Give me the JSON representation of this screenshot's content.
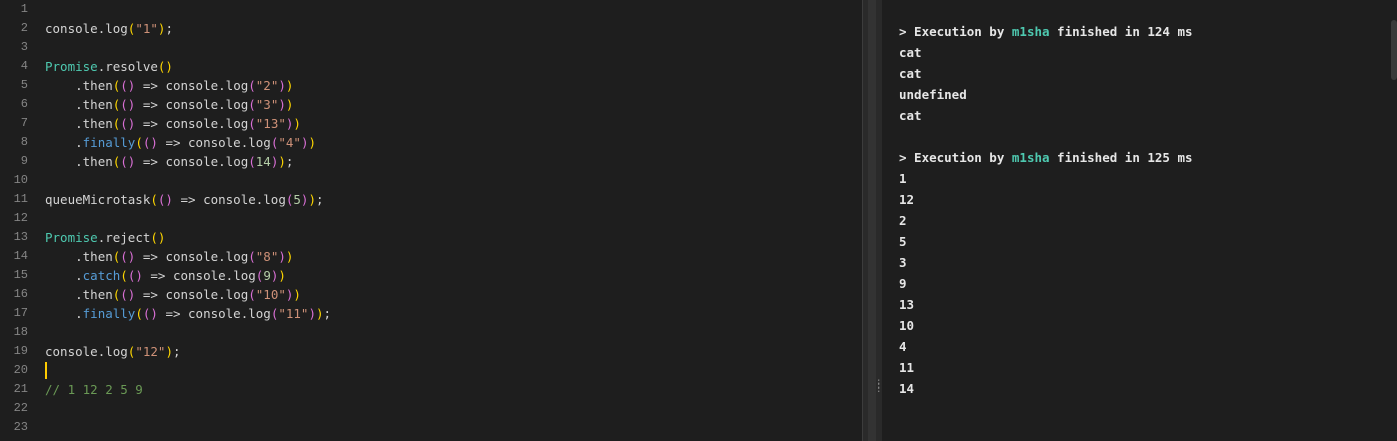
{
  "editor": {
    "line_numbers": [
      "1",
      "2",
      "3",
      "4",
      "5",
      "6",
      "7",
      "8",
      "9",
      "10",
      "11",
      "12",
      "13",
      "14",
      "15",
      "16",
      "17",
      "18",
      "19",
      "20",
      "21",
      "22",
      "23"
    ],
    "lines": [
      [],
      [
        {
          "t": "console",
          "c": "plain"
        },
        {
          "t": ".",
          "c": "pun"
        },
        {
          "t": "log",
          "c": "plain"
        },
        {
          "t": "(",
          "c": "b1"
        },
        {
          "t": "\"1\"",
          "c": "str"
        },
        {
          "t": ")",
          "c": "b1"
        },
        {
          "t": ";",
          "c": "pun"
        }
      ],
      [],
      [
        {
          "t": "Promise",
          "c": "cls"
        },
        {
          "t": ".",
          "c": "pun"
        },
        {
          "t": "resolve",
          "c": "plain"
        },
        {
          "t": "()",
          "c": "b1"
        }
      ],
      [
        {
          "t": "    ",
          "c": "plain"
        },
        {
          "t": ".",
          "c": "pun"
        },
        {
          "t": "then",
          "c": "plain"
        },
        {
          "t": "(",
          "c": "b1"
        },
        {
          "t": "()",
          "c": "b2"
        },
        {
          "t": " => ",
          "c": "plain"
        },
        {
          "t": "console",
          "c": "plain"
        },
        {
          "t": ".",
          "c": "pun"
        },
        {
          "t": "log",
          "c": "plain"
        },
        {
          "t": "(",
          "c": "b2"
        },
        {
          "t": "\"2\"",
          "c": "str"
        },
        {
          "t": ")",
          "c": "b2"
        },
        {
          "t": ")",
          "c": "b1"
        }
      ],
      [
        {
          "t": "    ",
          "c": "plain"
        },
        {
          "t": ".",
          "c": "pun"
        },
        {
          "t": "then",
          "c": "plain"
        },
        {
          "t": "(",
          "c": "b1"
        },
        {
          "t": "()",
          "c": "b2"
        },
        {
          "t": " => ",
          "c": "plain"
        },
        {
          "t": "console",
          "c": "plain"
        },
        {
          "t": ".",
          "c": "pun"
        },
        {
          "t": "log",
          "c": "plain"
        },
        {
          "t": "(",
          "c": "b2"
        },
        {
          "t": "\"3\"",
          "c": "str"
        },
        {
          "t": ")",
          "c": "b2"
        },
        {
          "t": ")",
          "c": "b1"
        }
      ],
      [
        {
          "t": "    ",
          "c": "plain"
        },
        {
          "t": ".",
          "c": "pun"
        },
        {
          "t": "then",
          "c": "plain"
        },
        {
          "t": "(",
          "c": "b1"
        },
        {
          "t": "()",
          "c": "b2"
        },
        {
          "t": " => ",
          "c": "plain"
        },
        {
          "t": "console",
          "c": "plain"
        },
        {
          "t": ".",
          "c": "pun"
        },
        {
          "t": "log",
          "c": "plain"
        },
        {
          "t": "(",
          "c": "b2"
        },
        {
          "t": "\"13\"",
          "c": "str"
        },
        {
          "t": ")",
          "c": "b2"
        },
        {
          "t": ")",
          "c": "b1"
        }
      ],
      [
        {
          "t": "    ",
          "c": "plain"
        },
        {
          "t": ".",
          "c": "pun"
        },
        {
          "t": "finally",
          "c": "kw"
        },
        {
          "t": "(",
          "c": "b1"
        },
        {
          "t": "()",
          "c": "b2"
        },
        {
          "t": " => ",
          "c": "plain"
        },
        {
          "t": "console",
          "c": "plain"
        },
        {
          "t": ".",
          "c": "pun"
        },
        {
          "t": "log",
          "c": "plain"
        },
        {
          "t": "(",
          "c": "b2"
        },
        {
          "t": "\"4\"",
          "c": "str"
        },
        {
          "t": ")",
          "c": "b2"
        },
        {
          "t": ")",
          "c": "b1"
        }
      ],
      [
        {
          "t": "    ",
          "c": "plain"
        },
        {
          "t": ".",
          "c": "pun"
        },
        {
          "t": "then",
          "c": "plain"
        },
        {
          "t": "(",
          "c": "b1"
        },
        {
          "t": "()",
          "c": "b2"
        },
        {
          "t": " => ",
          "c": "plain"
        },
        {
          "t": "console",
          "c": "plain"
        },
        {
          "t": ".",
          "c": "pun"
        },
        {
          "t": "log",
          "c": "plain"
        },
        {
          "t": "(",
          "c": "b2"
        },
        {
          "t": "14",
          "c": "num"
        },
        {
          "t": ")",
          "c": "b2"
        },
        {
          "t": ")",
          "c": "b1"
        },
        {
          "t": ";",
          "c": "pun"
        }
      ],
      [],
      [
        {
          "t": "queueMicrotask",
          "c": "plain"
        },
        {
          "t": "(",
          "c": "b1"
        },
        {
          "t": "()",
          "c": "b2"
        },
        {
          "t": " => ",
          "c": "plain"
        },
        {
          "t": "console",
          "c": "plain"
        },
        {
          "t": ".",
          "c": "pun"
        },
        {
          "t": "log",
          "c": "plain"
        },
        {
          "t": "(",
          "c": "b2"
        },
        {
          "t": "5",
          "c": "num"
        },
        {
          "t": ")",
          "c": "b2"
        },
        {
          "t": ")",
          "c": "b1"
        },
        {
          "t": ";",
          "c": "pun"
        }
      ],
      [],
      [
        {
          "t": "Promise",
          "c": "cls"
        },
        {
          "t": ".",
          "c": "pun"
        },
        {
          "t": "reject",
          "c": "plain"
        },
        {
          "t": "()",
          "c": "b1"
        }
      ],
      [
        {
          "t": "    ",
          "c": "plain"
        },
        {
          "t": ".",
          "c": "pun"
        },
        {
          "t": "then",
          "c": "plain"
        },
        {
          "t": "(",
          "c": "b1"
        },
        {
          "t": "()",
          "c": "b2"
        },
        {
          "t": " => ",
          "c": "plain"
        },
        {
          "t": "console",
          "c": "plain"
        },
        {
          "t": ".",
          "c": "pun"
        },
        {
          "t": "log",
          "c": "plain"
        },
        {
          "t": "(",
          "c": "b2"
        },
        {
          "t": "\"8\"",
          "c": "str"
        },
        {
          "t": ")",
          "c": "b2"
        },
        {
          "t": ")",
          "c": "b1"
        }
      ],
      [
        {
          "t": "    ",
          "c": "plain"
        },
        {
          "t": ".",
          "c": "pun"
        },
        {
          "t": "catch",
          "c": "kw"
        },
        {
          "t": "(",
          "c": "b1"
        },
        {
          "t": "()",
          "c": "b2"
        },
        {
          "t": " => ",
          "c": "plain"
        },
        {
          "t": "console",
          "c": "plain"
        },
        {
          "t": ".",
          "c": "pun"
        },
        {
          "t": "log",
          "c": "plain"
        },
        {
          "t": "(",
          "c": "b2"
        },
        {
          "t": "9",
          "c": "num"
        },
        {
          "t": ")",
          "c": "b2"
        },
        {
          "t": ")",
          "c": "b1"
        }
      ],
      [
        {
          "t": "    ",
          "c": "plain"
        },
        {
          "t": ".",
          "c": "pun"
        },
        {
          "t": "then",
          "c": "plain"
        },
        {
          "t": "(",
          "c": "b1"
        },
        {
          "t": "()",
          "c": "b2"
        },
        {
          "t": " => ",
          "c": "plain"
        },
        {
          "t": "console",
          "c": "plain"
        },
        {
          "t": ".",
          "c": "pun"
        },
        {
          "t": "log",
          "c": "plain"
        },
        {
          "t": "(",
          "c": "b2"
        },
        {
          "t": "\"10\"",
          "c": "str"
        },
        {
          "t": ")",
          "c": "b2"
        },
        {
          "t": ")",
          "c": "b1"
        }
      ],
      [
        {
          "t": "    ",
          "c": "plain"
        },
        {
          "t": ".",
          "c": "pun"
        },
        {
          "t": "finally",
          "c": "kw"
        },
        {
          "t": "(",
          "c": "b1"
        },
        {
          "t": "()",
          "c": "b2"
        },
        {
          "t": " => ",
          "c": "plain"
        },
        {
          "t": "console",
          "c": "plain"
        },
        {
          "t": ".",
          "c": "pun"
        },
        {
          "t": "log",
          "c": "plain"
        },
        {
          "t": "(",
          "c": "b2"
        },
        {
          "t": "\"11\"",
          "c": "str"
        },
        {
          "t": ")",
          "c": "b2"
        },
        {
          "t": ")",
          "c": "b1"
        },
        {
          "t": ";",
          "c": "pun"
        }
      ],
      [],
      [
        {
          "t": "console",
          "c": "plain"
        },
        {
          "t": ".",
          "c": "pun"
        },
        {
          "t": "log",
          "c": "plain"
        },
        {
          "t": "(",
          "c": "b1"
        },
        {
          "t": "\"12\"",
          "c": "str"
        },
        {
          "t": ")",
          "c": "b1"
        },
        {
          "t": ";",
          "c": "pun"
        }
      ],
      [],
      [
        {
          "t": "// 1 12 2 5 9",
          "c": "com"
        }
      ],
      [],
      []
    ],
    "cursor_line": 20
  },
  "output": {
    "runs": [
      {
        "prefix": "> Execution by ",
        "user": "m1sha",
        "suffix": " finished in 124 ms",
        "lines": [
          "cat",
          "cat",
          "undefined",
          "cat"
        ]
      },
      {
        "prefix": "> Execution by ",
        "user": "m1sha",
        "suffix": " finished in 125 ms",
        "lines": [
          "1",
          "12",
          "2",
          "5",
          "3",
          "9",
          "13",
          "10",
          "4",
          "11",
          "14"
        ]
      }
    ]
  },
  "colors": {
    "background": "#1e1e1e",
    "string": "#ce9178",
    "class": "#4ec9b0",
    "keyword": "#569cd6",
    "number": "#b5cea8",
    "comment": "#6a9955",
    "cursor": "#ffcc00"
  }
}
